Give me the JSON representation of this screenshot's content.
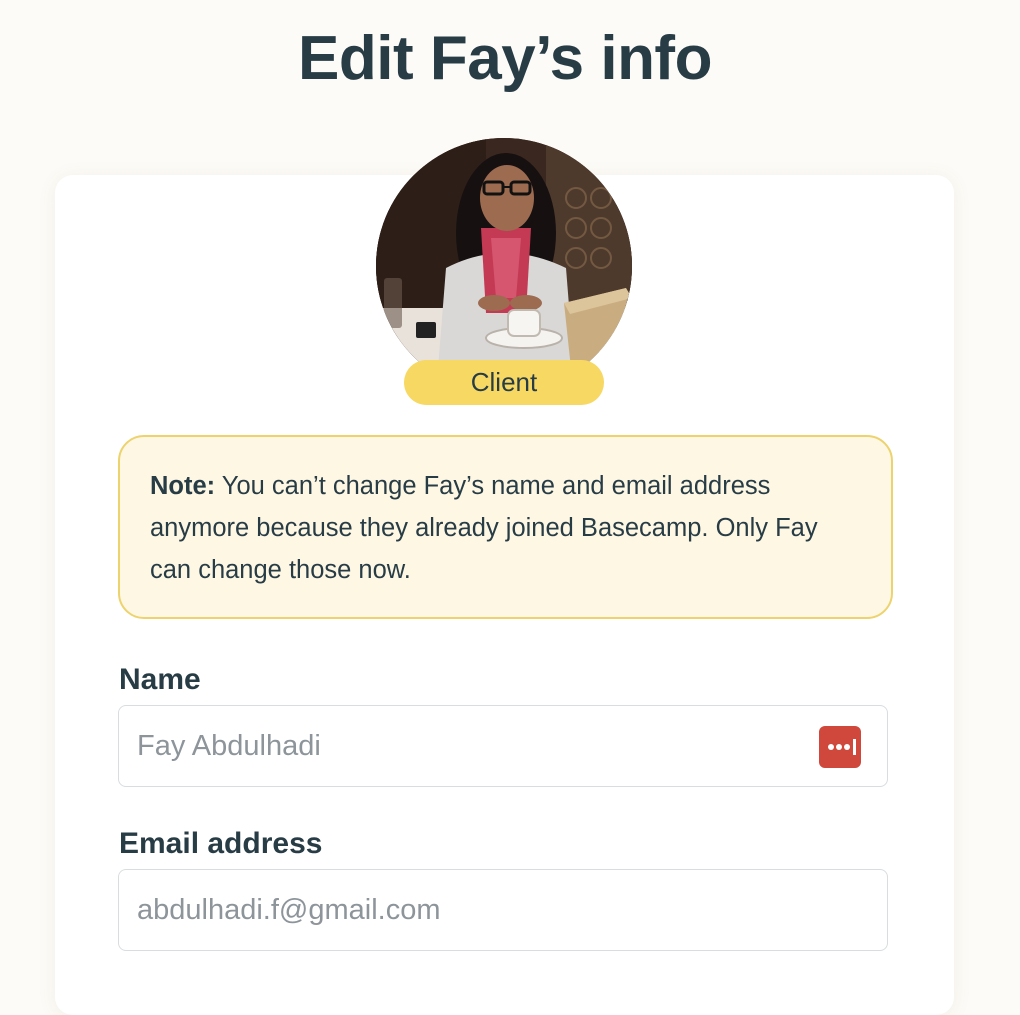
{
  "page": {
    "title": "Edit Fay’s info"
  },
  "profile": {
    "avatar_icon": "person-photo-avatar",
    "role_badge": "Client",
    "role_badge_color": "#f7d862"
  },
  "note": {
    "label": "Note:",
    "text": " You can’t change Fay’s name and email address anymore because they already joined Basecamp. Only Fay can change those now.",
    "background_color": "#fef7e4",
    "border_color": "#ecd36d"
  },
  "form": {
    "name": {
      "label": "Name",
      "value": "Fay Abdulhadi",
      "addon_icon": "password-manager-icon"
    },
    "email": {
      "label": "Email address",
      "value": "abdulhadi.f@gmail.com"
    }
  },
  "colors": {
    "background": "#fdfbf7",
    "text": "#283c46",
    "password_manager_icon": "#d0473b"
  }
}
